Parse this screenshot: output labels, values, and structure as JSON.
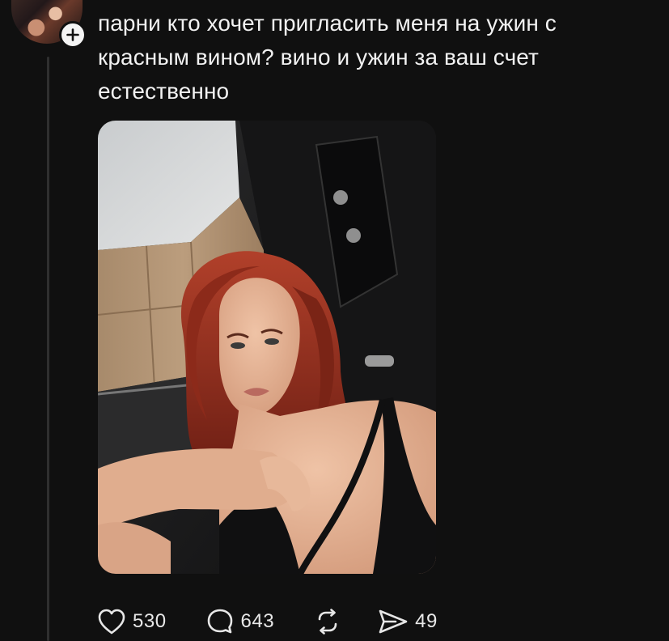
{
  "author": {
    "avatar_icon": "user-avatar",
    "follow_icon": "plus-icon"
  },
  "post": {
    "text": "парни кто хочет пригласить меня на ужин с красным вином? вино и ужин за ваш счет естественно",
    "image_icon": "selfie-photo"
  },
  "actions": {
    "like": {
      "icon": "heart-icon",
      "count": "530"
    },
    "reply": {
      "icon": "comment-icon",
      "count": "643"
    },
    "repost": {
      "icon": "repost-icon"
    },
    "share": {
      "icon": "share-icon",
      "count": "49"
    }
  },
  "colors": {
    "background": "#101010",
    "text": "#f2f2f2",
    "thread_line": "#2f2f2f",
    "badge": "#f4f4f4"
  }
}
